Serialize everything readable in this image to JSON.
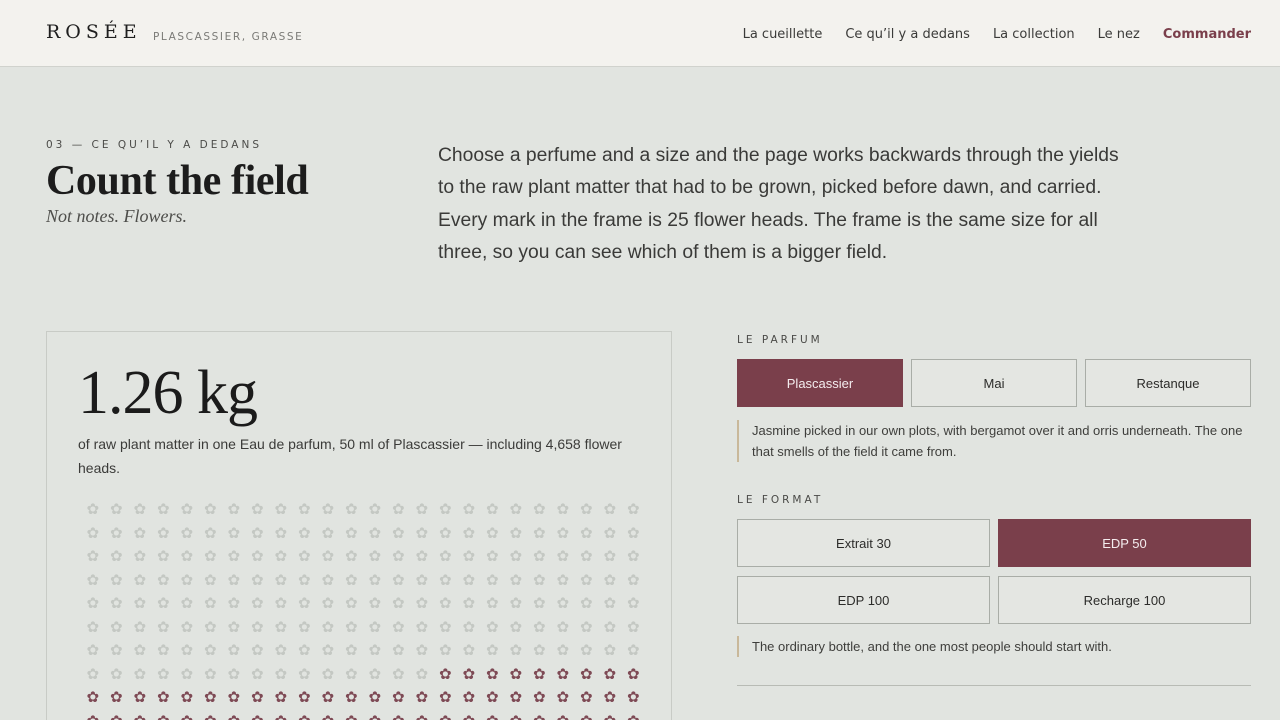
{
  "header": {
    "brand": "ROSÉE",
    "location": "PLASCASSIER, GRASSE",
    "nav": [
      "La cueillette",
      "Ce qu’il y a dedans",
      "La collection",
      "Le nez"
    ],
    "order_label": "Commander"
  },
  "section": {
    "eyebrow": "03 — CE QU’IL Y A DEDANS",
    "title": "Count the field",
    "subtitle": "Not notes. Flowers.",
    "intro": "Choose a perfume and a size and the page works backwards through the yields to the raw plant matter that had to be grown, picked before dawn, and carried. Every mark in the frame is 25 flower heads. The frame is the same size for all three, so you can see which of them is a bigger field."
  },
  "result": {
    "weight": "1.26 kg",
    "caption": "of raw plant matter in one Eau de parfum, 50 ml of Plascassier — including 4,658 flower heads.",
    "mark_glyph": "✿",
    "columns": 24,
    "visible_rows": 10,
    "filled_from": 183,
    "empty_color": "#c4c8c3",
    "filled_color": "#7e4a55"
  },
  "parfum": {
    "label": "LE PARFUM",
    "options": [
      "Plascassier",
      "Mai",
      "Restanque"
    ],
    "selected": 0,
    "note": "Jasmine picked in our own plots, with bergamot over it and orris underneath. The one that smells of the field it came from."
  },
  "format": {
    "label": "LE FORMAT",
    "options": [
      "Extrait 30",
      "EDP 50",
      "EDP 100",
      "Recharge 100"
    ],
    "selected": 1,
    "note": "The ordinary bottle, and the one most people should start with."
  },
  "colors": {
    "accent": "#7a3f4b",
    "background": "#e1e4e0",
    "header": "#f3f2ee"
  }
}
